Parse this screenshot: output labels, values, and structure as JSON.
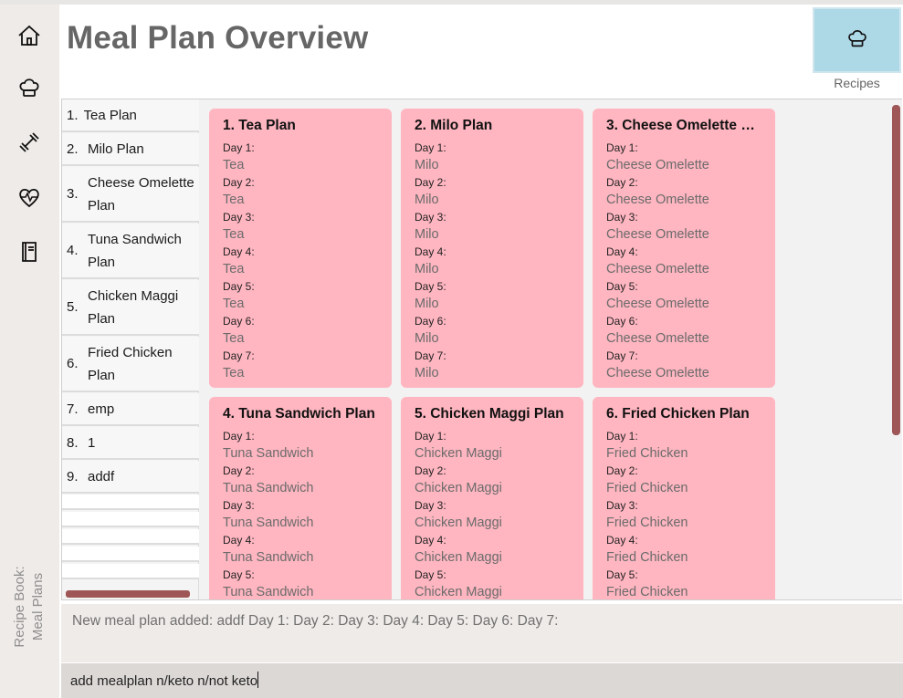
{
  "window": {
    "title": "Meal Plan Overview",
    "caption_line1": "Recipe Book:",
    "caption_line2": "Meal Plans"
  },
  "rail": {
    "icons": [
      "home-icon",
      "chef-hat-icon",
      "dumbbell-icon",
      "heartbeat-icon",
      "book-icon"
    ]
  },
  "header": {
    "recipes_label": "Recipes",
    "recipes_button_color": "#add8e6"
  },
  "plan_list": {
    "items": [
      {
        "num": "1.",
        "name": "Tea Plan"
      },
      {
        "num": "2.",
        "name": "Milo Plan"
      },
      {
        "num": "3.",
        "name": "Cheese Omelette Plan"
      },
      {
        "num": "4.",
        "name": "Tuna Sandwich Plan"
      },
      {
        "num": "5.",
        "name": "Chicken Maggi Plan"
      },
      {
        "num": "6.",
        "name": "Fried Chicken Plan"
      },
      {
        "num": "7.",
        "name": "emp"
      },
      {
        "num": "8.",
        "name": "1"
      },
      {
        "num": "9.",
        "name": "addf"
      }
    ]
  },
  "cards": [
    {
      "title": "1.  Tea Plan",
      "days": [
        "Day 1:",
        "Tea",
        "Day 2:",
        "Tea",
        "Day 3:",
        "Tea",
        "Day 4:",
        "Tea",
        "Day 5:",
        "Tea",
        "Day 6:",
        "Tea",
        "Day 7:",
        "Tea"
      ]
    },
    {
      "title": "2.  Milo Plan",
      "days": [
        "Day 1:",
        "Milo",
        "Day 2:",
        "Milo",
        "Day 3:",
        "Milo",
        "Day 4:",
        "Milo",
        "Day 5:",
        "Milo",
        "Day 6:",
        "Milo",
        "Day 7:",
        "Milo"
      ]
    },
    {
      "title": "3.  Cheese Omelette Pl...",
      "days": [
        "Day 1:",
        "Cheese Omelette",
        "Day 2:",
        "Cheese Omelette",
        "Day 3:",
        "Cheese Omelette",
        "Day 4:",
        "Cheese Omelette",
        "Day 5:",
        "Cheese Omelette",
        "Day 6:",
        "Cheese Omelette",
        "Day 7:",
        "Cheese Omelette"
      ]
    },
    {
      "title": "4.  Tuna Sandwich Plan",
      "days": [
        "Day 1:",
        "Tuna Sandwich",
        "Day 2:",
        "Tuna Sandwich",
        "Day 3:",
        "Tuna Sandwich",
        "Day 4:",
        "Tuna Sandwich",
        "Day 5:",
        "Tuna Sandwich"
      ]
    },
    {
      "title": "5.  Chicken Maggi Plan",
      "days": [
        "Day 1:",
        "Chicken Maggi",
        "Day 2:",
        "Chicken Maggi",
        "Day 3:",
        "Chicken Maggi",
        "Day 4:",
        "Chicken Maggi",
        "Day 5:",
        "Chicken Maggi"
      ]
    },
    {
      "title": "6.  Fried Chicken Plan",
      "days": [
        "Day 1:",
        "Fried Chicken",
        "Day 2:",
        "Fried Chicken",
        "Day 3:",
        "Fried Chicken",
        "Day 4:",
        "Fried Chicken",
        "Day 5:",
        "Fried Chicken"
      ]
    }
  ],
  "result": {
    "text": "New meal plan added: addf Day 1:  Day 2:  Day 3:  Day 4:  Day 5:  Day 6:  Day 7:"
  },
  "command": {
    "value": "add mealplan n/keto n/not keto"
  },
  "colors": {
    "card": "#ffb6c1",
    "scroll_thumb": "#9e5656",
    "rail": "#efebe8"
  }
}
